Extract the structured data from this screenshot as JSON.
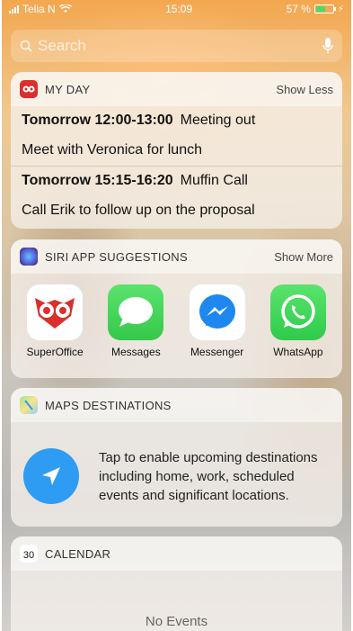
{
  "status": {
    "carrier": "Telia N",
    "time": "15:09",
    "battery": "57 %",
    "battery_level": 0.57
  },
  "search": {
    "placeholder": "Search"
  },
  "my_day": {
    "title": "MY DAY",
    "action": "Show Less",
    "events": [
      {
        "time": "Tomorrow 12:00-13:00",
        "title": "Meeting out",
        "detail": "Meet with Veronica for lunch"
      },
      {
        "time": "Tomorrow 15:15-16:20",
        "title": "Muffin Call",
        "detail": "Call Erik to follow up on the proposal"
      }
    ]
  },
  "siri": {
    "title": "SIRI APP SUGGESTIONS",
    "action": "Show More",
    "apps": [
      {
        "label": "SuperOffice",
        "icon": "superoffice-owl-icon"
      },
      {
        "label": "Messages",
        "icon": "messages-icon"
      },
      {
        "label": "Messenger",
        "icon": "messenger-icon"
      },
      {
        "label": "WhatsApp",
        "icon": "whatsapp-icon"
      }
    ]
  },
  "maps": {
    "title": "MAPS DESTINATIONS",
    "text": "Tap to enable upcoming destinations including home, work, scheduled events and significant locations."
  },
  "calendar": {
    "title": "CALENDAR",
    "icon_day": "30",
    "empty": "No Events"
  },
  "colors": {
    "superoffice_red": "#d9302c",
    "messages_green": "#35c84a",
    "messenger_blue": "#1e87f0",
    "whatsapp_green": "#2ecb4a",
    "maps_blue": "#2f9cf3"
  }
}
